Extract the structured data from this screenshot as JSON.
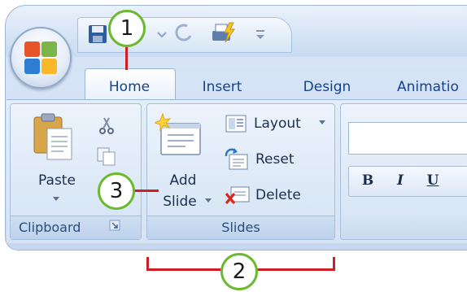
{
  "tabs": [
    "Home",
    "Insert",
    "Design",
    "Animatio"
  ],
  "clipboard": {
    "paste": "Paste",
    "group_label": "Clipboard"
  },
  "slides": {
    "add_slide_line1": "Add",
    "add_slide_line2": "Slide",
    "layout": "Layout",
    "reset": "Reset",
    "delete": "Delete",
    "group_label": "Slides"
  },
  "font": {
    "bold": "B",
    "italic": "I",
    "underline": "U"
  },
  "callouts": [
    "1",
    "2",
    "3"
  ],
  "colors": {
    "callout_ring": "#6bb92f",
    "callout_line": "#cc1f26",
    "tab_text": "#15428b"
  }
}
